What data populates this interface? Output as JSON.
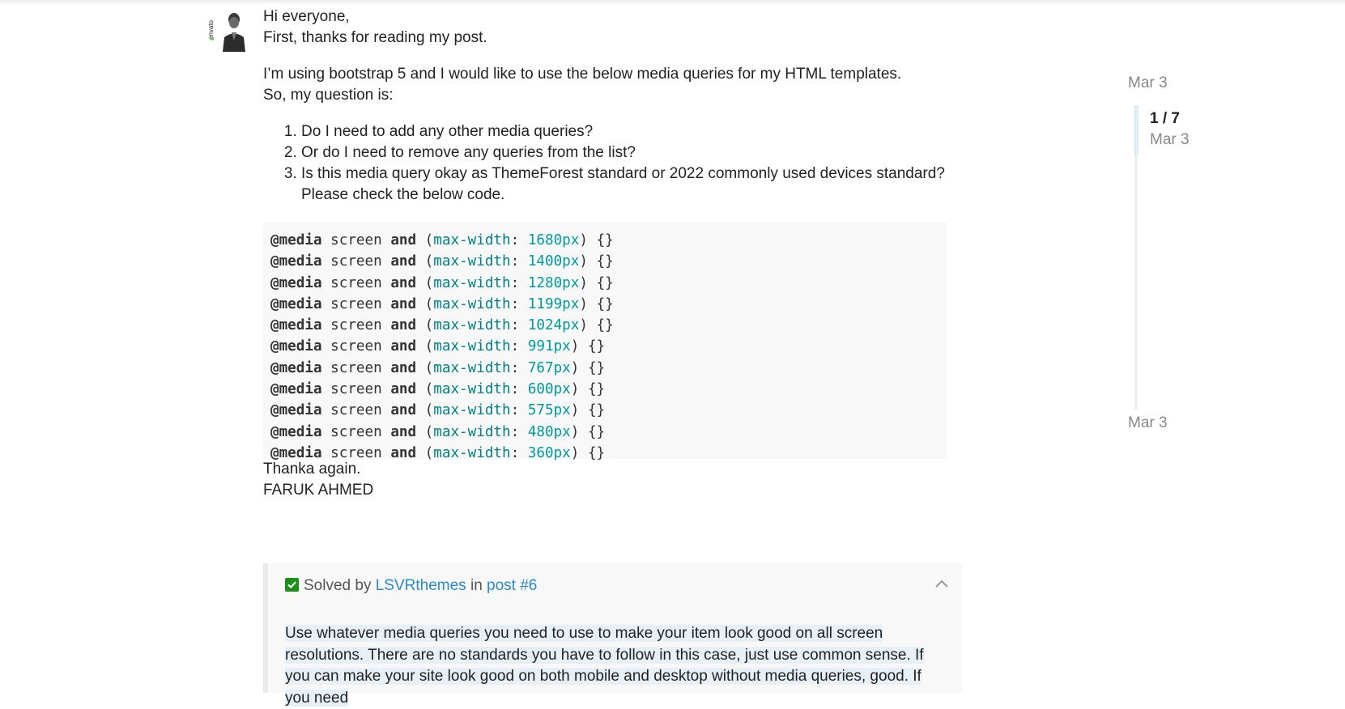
{
  "post": {
    "greeting": "Hi everyone,",
    "intro": "First, thanks for reading my post.",
    "para1": "I’m using bootstrap 5 and I would like to use the below media queries for my HTML templates.",
    "para2": "So, my question is:",
    "questions": [
      "Do I need to add any other media queries?",
      "Or do I need to remove any queries from the list?",
      "Is this media query okay as ThemeForest standard or 2022 commonly used devices standard?"
    ],
    "check_note": "Please check the below code.",
    "code": {
      "at": "@media",
      "screen": "screen",
      "and": "and",
      "prop": "max-width",
      "values": [
        "1680px",
        "1400px",
        "1280px",
        "1199px",
        "1024px",
        "991px",
        "767px",
        "600px",
        "575px",
        "480px",
        "360px"
      ]
    },
    "thanks": "Thanka again.",
    "signature": "FARUK AHMED",
    "avatar_text": "envato"
  },
  "solution": {
    "prefix": "Solved by",
    "author": "LSVRthemes",
    "in": "in",
    "post_link": "post #6",
    "text": "Use whatever media queries you need to use to make your item look good on all screen resolutions. There are no standards you have to follow in this case, just use common sense. If you can make your site look good on both mobile and desktop without media queries, good. If you need"
  },
  "timeline": {
    "start_date": "Mar 3",
    "position": "1 / 7",
    "position_date": "Mar 3",
    "end_date": "Mar 3"
  },
  "colors": {
    "link": "#2b8bc8",
    "check": "#1a8f1a",
    "code_prop": "#008080",
    "code_num": "#009999"
  }
}
